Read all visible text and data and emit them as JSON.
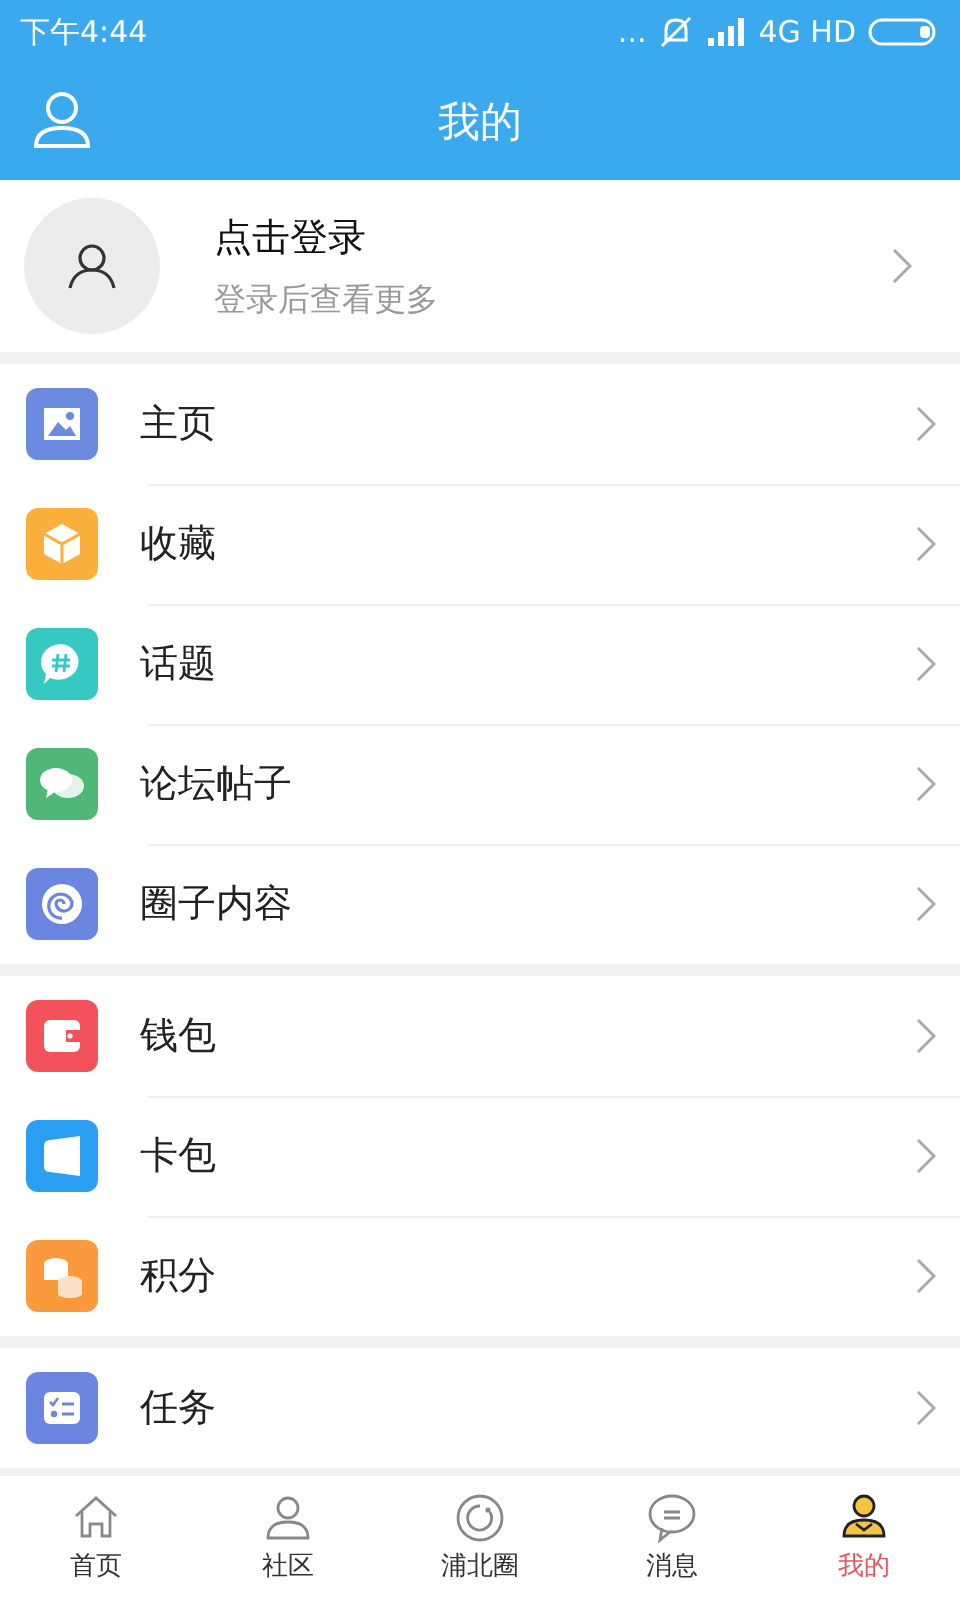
{
  "status_bar": {
    "time": "下午4:44",
    "dots": "...",
    "network": "4G HD"
  },
  "header": {
    "title": "我的"
  },
  "profile": {
    "name": "点击登录",
    "hint": "登录后查看更多"
  },
  "groups": [
    {
      "items": [
        {
          "label": "主页",
          "kind": "image",
          "color": "#6a8be0"
        },
        {
          "label": "收藏",
          "kind": "box",
          "color": "#fbb03b"
        },
        {
          "label": "话题",
          "kind": "hash",
          "color": "#36c9c4"
        },
        {
          "label": "论坛帖子",
          "kind": "chat",
          "color": "#4fb878"
        },
        {
          "label": "圈子内容",
          "kind": "swirl",
          "color": "#6a86e0"
        }
      ]
    },
    {
      "items": [
        {
          "label": "钱包",
          "kind": "wallet",
          "color": "#f4525a"
        },
        {
          "label": "卡包",
          "kind": "card",
          "color": "#2a9ef0"
        },
        {
          "label": "积分",
          "kind": "coins",
          "color": "#fb9a3c"
        }
      ]
    },
    {
      "items": [
        {
          "label": "任务",
          "kind": "tasks",
          "color": "#6a86e0"
        }
      ]
    }
  ],
  "tabs": [
    {
      "label": "首页",
      "kind": "home",
      "selected": false
    },
    {
      "label": "社区",
      "kind": "person",
      "selected": false
    },
    {
      "label": "浦北圈",
      "kind": "circle",
      "selected": false
    },
    {
      "label": "消息",
      "kind": "bubble",
      "selected": false
    },
    {
      "label": "我的",
      "kind": "me",
      "selected": true
    }
  ]
}
